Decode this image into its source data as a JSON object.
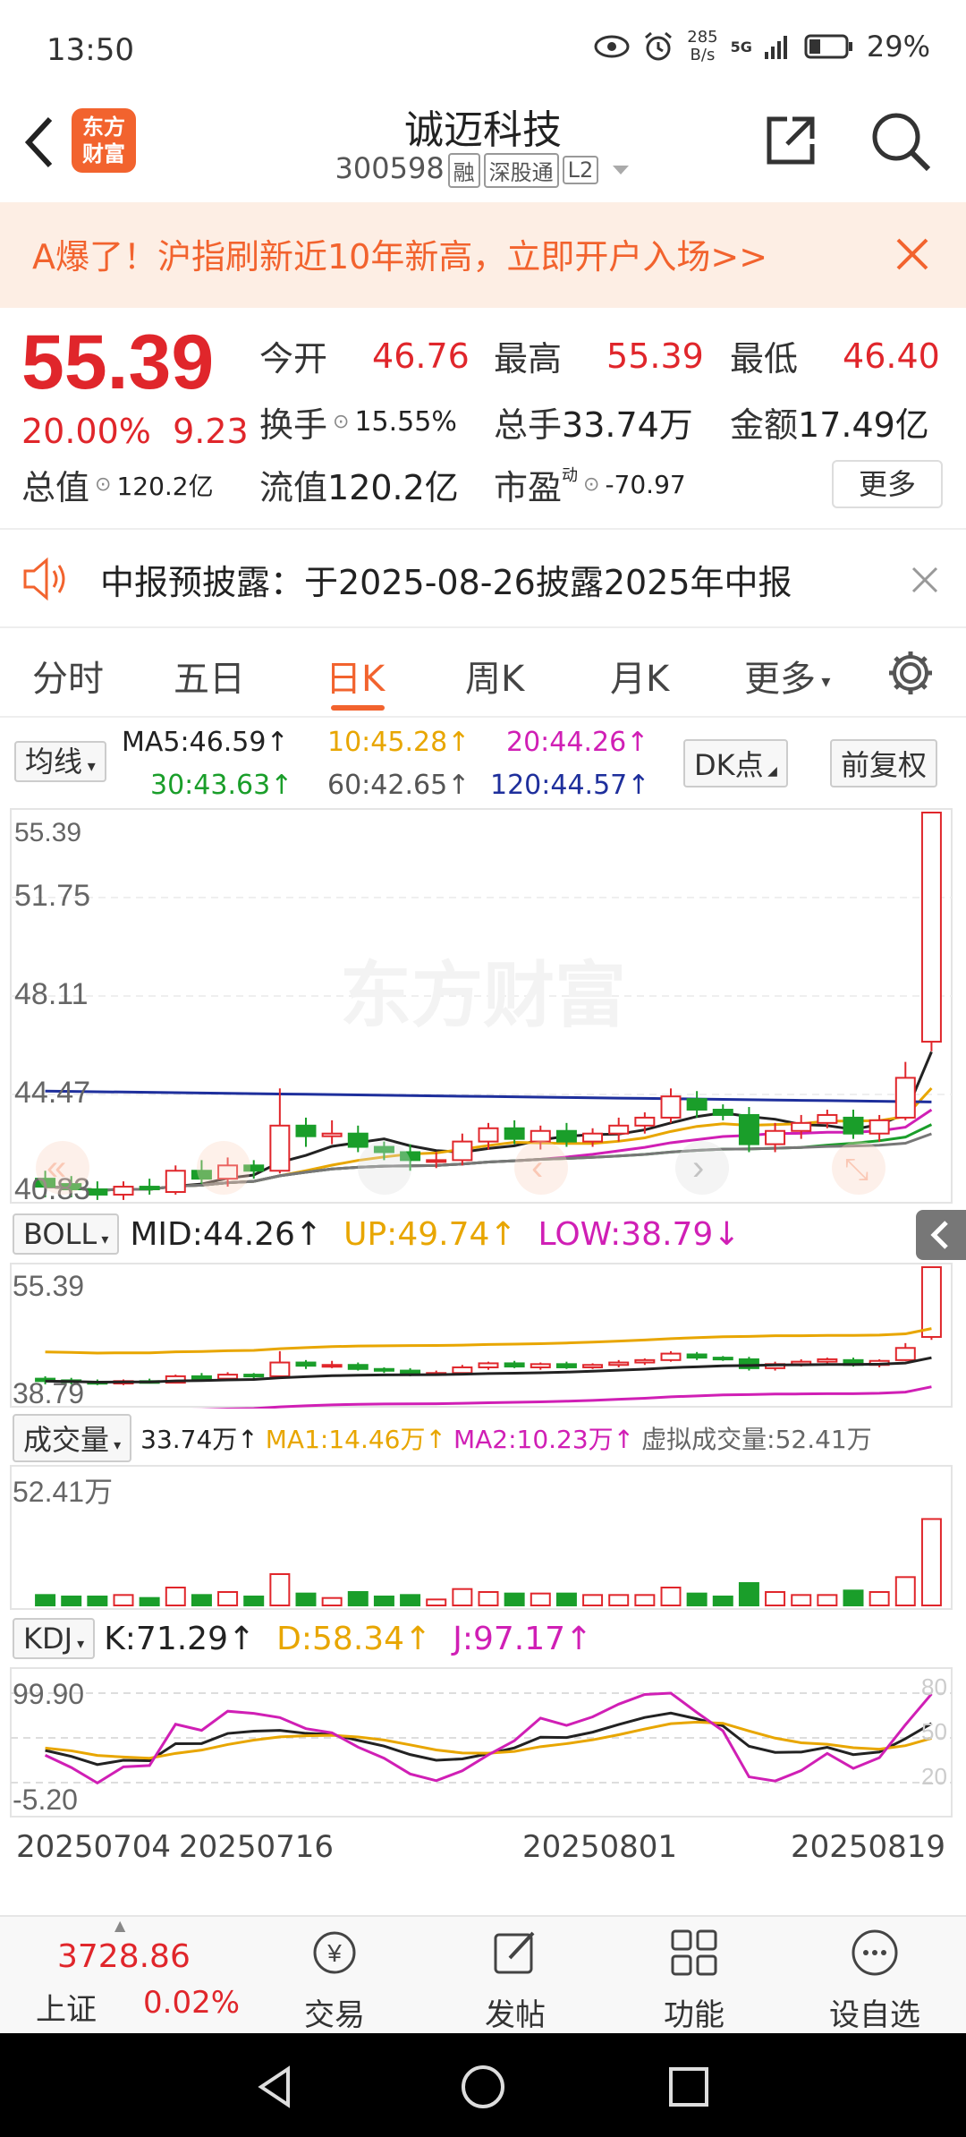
{
  "status": {
    "time": "13:50",
    "speed_top": "285",
    "speed_bottom": "B/s",
    "net": "5G",
    "battery": "29%"
  },
  "header": {
    "title": "诚迈科技",
    "code": "300598",
    "tags": [
      "融",
      "深股通",
      "L2"
    ]
  },
  "banner": {
    "text": "A爆了！沪指刷新近10年新高，立即开户入场>>"
  },
  "quote": {
    "price": "55.39",
    "pct": "20.00%",
    "change": "9.23",
    "open_label": "今开",
    "open": "46.76",
    "high_label": "最高",
    "high": "55.39",
    "low_label": "最低",
    "low": "46.40",
    "turnover_label": "换手",
    "turnover": "15.55%",
    "volume_label": "总手",
    "volume": "33.74万",
    "amount_label": "金额",
    "amount": "17.49亿",
    "mcap_label": "总值",
    "mcap": "120.2亿",
    "float_label": "流值",
    "float": "120.2亿",
    "pe_label": "市盈",
    "pe_sup": "动",
    "pe": "-70.97",
    "more": "更多"
  },
  "notice": {
    "text": "中报预披露：于2025-08-26披露2025年中报"
  },
  "tabs": [
    "分时",
    "五日",
    "日K",
    "周K",
    "月K",
    "更多"
  ],
  "ma": {
    "selector": "均线",
    "ma5": "MA5:46.59↑",
    "ma10": "10:45.28↑",
    "ma20": "20:44.26↑",
    "ma30": "30:43.63↑",
    "ma60": "60:42.65↑",
    "ma120": "120:44.57↑",
    "dk": "DK点",
    "adjust": "前复权"
  },
  "main_axis": [
    "55.39",
    "51.75",
    "48.11",
    "44.47",
    "40.83"
  ],
  "watermark": "东方财富",
  "boll": {
    "selector": "BOLL",
    "mid": "MID:44.26↑",
    "up": "UP:49.74↑",
    "low": "LOW:38.79↓",
    "axis_top": "55.39",
    "axis_bottom": "38.79"
  },
  "vol": {
    "selector": "成交量",
    "value": "33.74万↑",
    "ma1": "MA1:14.46万↑",
    "ma2": "MA2:10.23万↑",
    "virtual": "虚拟成交量:52.41万",
    "axis_top": "52.41万"
  },
  "kdj": {
    "selector": "KDJ",
    "k": "K:71.29↑",
    "d": "D:58.34↑",
    "j": "J:97.17↑",
    "axis_top": "99.90",
    "axis_bottom": "-5.20",
    "ref": [
      "80",
      "50",
      "20"
    ]
  },
  "dates": [
    "20250704",
    "20250716",
    "20250801",
    "20250819"
  ],
  "bottom": {
    "index_value": "3728.86",
    "index_name": "上证",
    "index_pct": "0.02%",
    "items": [
      "交易",
      "发帖",
      "功能",
      "设自选"
    ]
  },
  "colors": {
    "up": "#e0262b",
    "down": "#1a9e2a",
    "accent": "#f2632e",
    "ma120": "#1e2f9c"
  },
  "chart_data": {
    "type": "candlestick",
    "ylim": [
      40.83,
      55.39
    ],
    "candles": [
      {
        "o": 41.6,
        "c": 41.3,
        "h": 41.9,
        "l": 40.9
      },
      {
        "o": 41.4,
        "c": 41.2,
        "h": 41.7,
        "l": 40.9
      },
      {
        "o": 41.2,
        "c": 41.0,
        "h": 41.5,
        "l": 40.8
      },
      {
        "o": 41.0,
        "c": 41.3,
        "h": 41.5,
        "l": 40.8
      },
      {
        "o": 41.3,
        "c": 41.2,
        "h": 41.6,
        "l": 41.0
      },
      {
        "o": 41.1,
        "c": 41.9,
        "h": 42.1,
        "l": 41.0
      },
      {
        "o": 41.9,
        "c": 41.6,
        "h": 42.3,
        "l": 41.4
      },
      {
        "o": 41.6,
        "c": 42.1,
        "h": 42.4,
        "l": 41.3
      },
      {
        "o": 42.1,
        "c": 41.9,
        "h": 42.3,
        "l": 41.6
      },
      {
        "o": 41.9,
        "c": 43.6,
        "h": 45.0,
        "l": 41.8
      },
      {
        "o": 43.6,
        "c": 43.2,
        "h": 43.9,
        "l": 42.8
      },
      {
        "o": 43.2,
        "c": 43.3,
        "h": 43.8,
        "l": 42.9
      },
      {
        "o": 43.3,
        "c": 42.8,
        "h": 43.6,
        "l": 42.6
      },
      {
        "o": 42.8,
        "c": 42.6,
        "h": 43.0,
        "l": 42.3
      },
      {
        "o": 42.6,
        "c": 42.3,
        "h": 42.9,
        "l": 41.9
      },
      {
        "o": 42.3,
        "c": 42.3,
        "h": 42.6,
        "l": 42.0
      },
      {
        "o": 42.3,
        "c": 43.0,
        "h": 43.3,
        "l": 42.1
      },
      {
        "o": 43.0,
        "c": 43.5,
        "h": 43.7,
        "l": 42.7
      },
      {
        "o": 43.5,
        "c": 43.1,
        "h": 43.8,
        "l": 42.9
      },
      {
        "o": 43.0,
        "c": 43.4,
        "h": 43.6,
        "l": 42.7
      },
      {
        "o": 43.4,
        "c": 43.0,
        "h": 43.7,
        "l": 42.8
      },
      {
        "o": 43.0,
        "c": 43.3,
        "h": 43.5,
        "l": 42.8
      },
      {
        "o": 43.3,
        "c": 43.6,
        "h": 43.9,
        "l": 43.0
      },
      {
        "o": 43.6,
        "c": 43.9,
        "h": 44.1,
        "l": 43.3
      },
      {
        "o": 43.9,
        "c": 44.7,
        "h": 45.0,
        "l": 43.7
      },
      {
        "o": 44.6,
        "c": 44.2,
        "h": 44.9,
        "l": 43.9
      },
      {
        "o": 44.2,
        "c": 44.0,
        "h": 44.4,
        "l": 43.8
      },
      {
        "o": 44.0,
        "c": 42.9,
        "h": 44.3,
        "l": 42.6
      },
      {
        "o": 42.9,
        "c": 43.4,
        "h": 43.7,
        "l": 42.6
      },
      {
        "o": 43.4,
        "c": 43.7,
        "h": 44.0,
        "l": 43.1
      },
      {
        "o": 43.7,
        "c": 44.0,
        "h": 44.2,
        "l": 43.5
      },
      {
        "o": 43.9,
        "c": 43.3,
        "h": 44.2,
        "l": 43.1
      },
      {
        "o": 43.3,
        "c": 43.8,
        "h": 44.0,
        "l": 43.0
      },
      {
        "o": 43.9,
        "c": 45.4,
        "h": 46.0,
        "l": 43.8
      },
      {
        "o": 46.76,
        "c": 55.39,
        "h": 55.39,
        "l": 46.4
      }
    ]
  }
}
